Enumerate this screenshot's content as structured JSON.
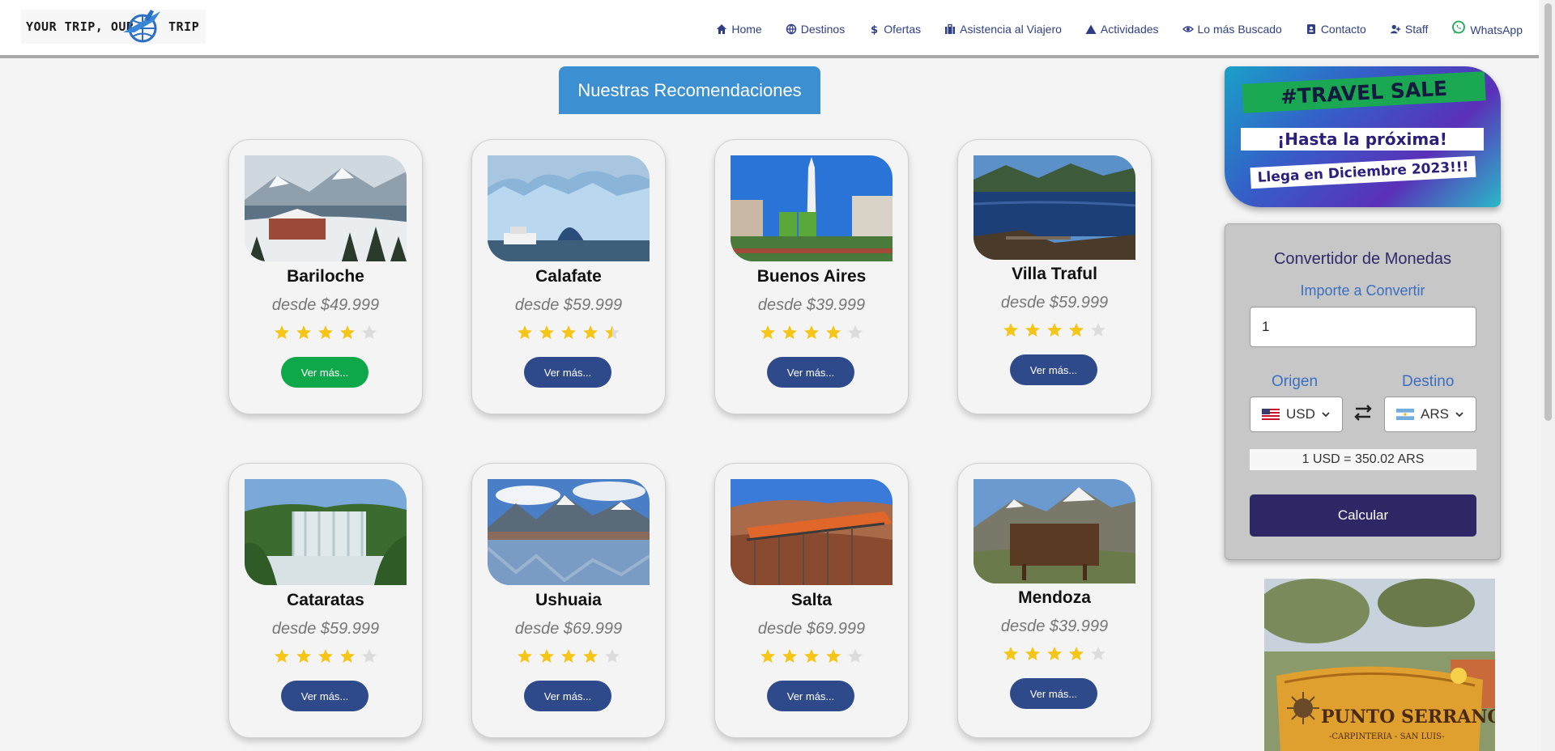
{
  "brand": {
    "logo_left": "YOUR TRIP, OUR",
    "logo_right": "TRIP"
  },
  "nav": {
    "items": [
      {
        "label": "Home",
        "icon": "home-icon"
      },
      {
        "label": "Destinos",
        "icon": "globe-icon"
      },
      {
        "label": "Ofertas",
        "icon": "dollar-icon"
      },
      {
        "label": "Asistencia al Viajero",
        "icon": "briefcase-icon"
      },
      {
        "label": "Actividades",
        "icon": "mountain-icon"
      },
      {
        "label": "Lo más Buscado",
        "icon": "eye-icon"
      },
      {
        "label": "Contacto",
        "icon": "contact-card-icon"
      },
      {
        "label": "Staff",
        "icon": "user-plus-icon"
      },
      {
        "label": "WhatsApp",
        "icon": "whatsapp-icon"
      }
    ]
  },
  "main": {
    "title": "Nuestras Recomendaciones"
  },
  "cards": [
    {
      "name": "Bariloche",
      "price": "desde $49.999",
      "rating": 4,
      "button": "Ver más..."
    },
    {
      "name": "Calafate",
      "price": "desde $59.999",
      "rating": 4.5,
      "button": "Ver más..."
    },
    {
      "name": "Buenos Aires",
      "price": "desde $39.999",
      "rating": 4,
      "button": "Ver más..."
    },
    {
      "name": "Villa Traful",
      "price": "desde $59.999",
      "rating": 4,
      "button": "Ver más..."
    },
    {
      "name": "Cataratas",
      "price": "desde $59.999",
      "rating": 4,
      "button": "Ver más..."
    },
    {
      "name": "Ushuaia",
      "price": "desde $69.999",
      "rating": 4,
      "button": "Ver más..."
    },
    {
      "name": "Salta",
      "price": "desde $69.999",
      "rating": 4,
      "button": "Ver más..."
    },
    {
      "name": "Mendoza",
      "price": "desde $39.999",
      "rating": 4,
      "button": "Ver más..."
    }
  ],
  "sale": {
    "tag": "#TRAVEL SALE",
    "line1": "¡Hasta la próxima!",
    "line2": "Llega en Diciembre 2023!!!"
  },
  "converter": {
    "title": "Convertidor de Monedas",
    "amount_label": "Importe a Convertir",
    "amount_value": "1",
    "origin_label": "Origen",
    "destination_label": "Destino",
    "origin_currency": "USD",
    "destination_currency": "ARS",
    "rate_text": "1 USD = 350.02 ARS",
    "calc_button": "Calcular"
  },
  "colors": {
    "nav_text": "#2f3f86",
    "title_bg": "#3c8fd1",
    "button_blue": "#2f4a8a",
    "button_green": "#0ea84b",
    "star": "#f5c518",
    "calc_bg": "#2e2766"
  }
}
